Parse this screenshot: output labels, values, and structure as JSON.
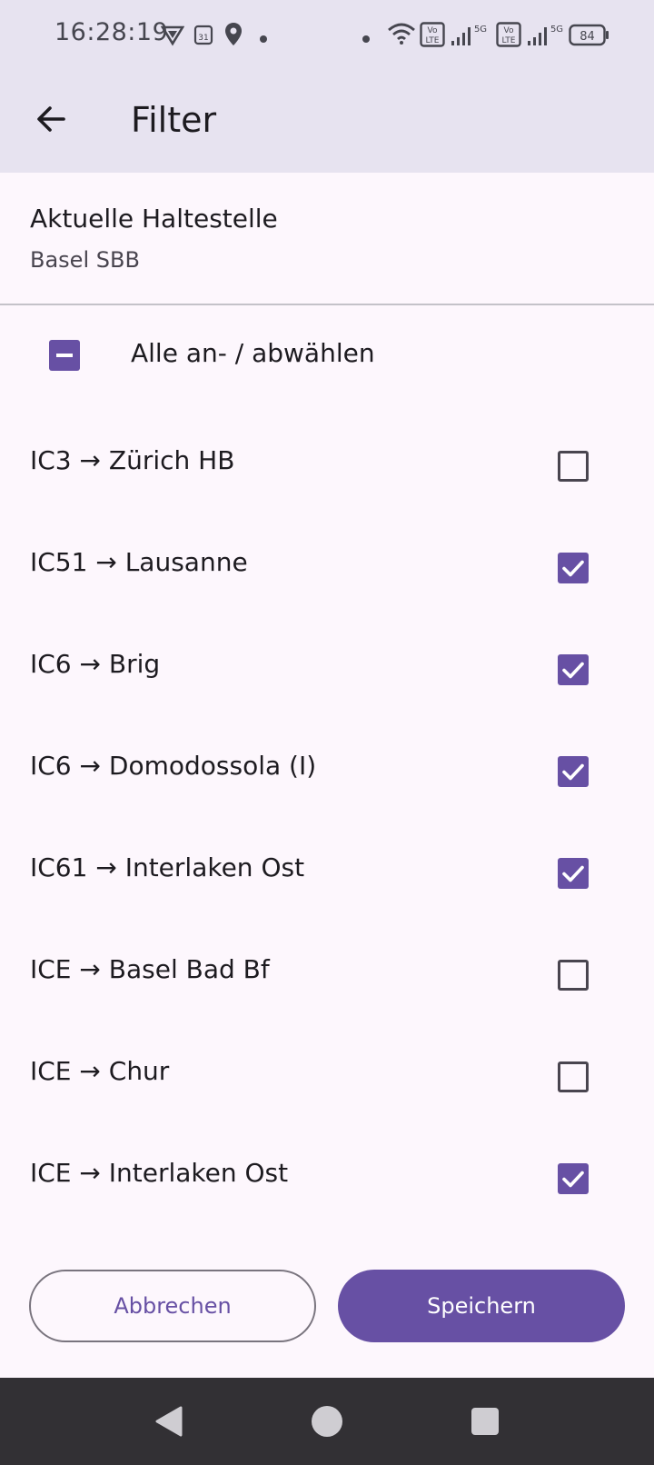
{
  "status_bar": {
    "time": "16:28:19",
    "battery": "84",
    "network_labels": [
      "5G",
      "5G"
    ],
    "volte_label": "Vo LTE",
    "icons": [
      "vpn-icon",
      "calendar-icon",
      "location-icon",
      "dot-icon",
      "dot-icon",
      "wifi-icon",
      "volte-icon",
      "signal-icon",
      "volte-icon",
      "signal-icon",
      "battery-icon"
    ]
  },
  "app_bar": {
    "title": "Filter",
    "back_icon": "arrow-back-icon"
  },
  "station": {
    "label": "Aktuelle Haltestelle",
    "value": "Basel SBB"
  },
  "select_all": {
    "label": "Alle an- / abwählen",
    "state": "indeterminate"
  },
  "routes": [
    {
      "label": "IC3 → Zürich HB",
      "checked": false
    },
    {
      "label": "IC51 → Lausanne",
      "checked": true
    },
    {
      "label": "IC6 → Brig",
      "checked": true
    },
    {
      "label": "IC6 → Domodossola (I)",
      "checked": true
    },
    {
      "label": "IC61 → Interlaken Ost",
      "checked": true
    },
    {
      "label": "ICE → Basel Bad Bf",
      "checked": false
    },
    {
      "label": "ICE → Chur",
      "checked": false
    },
    {
      "label": "ICE → Interlaken Ost",
      "checked": true
    }
  ],
  "buttons": {
    "cancel": "Abbrechen",
    "save": "Speichern"
  },
  "colors": {
    "primary": "#6750a4",
    "surface": "#fdf7fd",
    "app_bar": "#e7e3f0",
    "nav_bar": "#323034"
  },
  "nav_bar": {
    "icons": [
      "nav-back-icon",
      "nav-home-icon",
      "nav-recents-icon"
    ]
  }
}
